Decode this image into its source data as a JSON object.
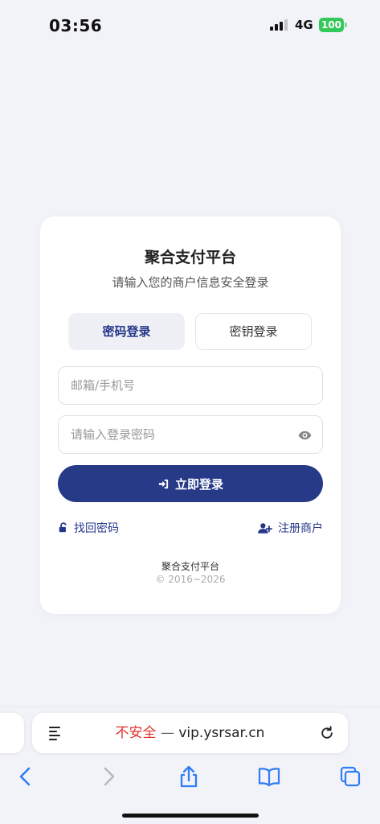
{
  "status_bar": {
    "time": "03:56",
    "network": "4G",
    "battery": "100",
    "signal_bars_active": 3,
    "signal_bars_total": 4
  },
  "login_card": {
    "title": "聚合支付平台",
    "subtitle": "请输入您的商户信息安全登录",
    "tabs": [
      {
        "label": "密码登录",
        "active": true
      },
      {
        "label": "密钥登录",
        "active": false
      }
    ],
    "email_input": {
      "placeholder": "邮箱/手机号",
      "value": ""
    },
    "password_input": {
      "placeholder": "请输入登录密码",
      "value": ""
    },
    "login_button": "立即登录",
    "forgot_link": "找回密码",
    "register_link": "注册商户",
    "footer_name": "聚合支付平台",
    "footer_copyright": "© 2016~2026"
  },
  "browser": {
    "url_warning": "不安全",
    "url_separator": "—",
    "url_domain": "vip.ysrsar.cn"
  },
  "icons": {
    "lock_open": "unlock-icon",
    "user_plus": "user-plus-icon",
    "sign_in": "sign-in-icon",
    "eye": "eye-icon",
    "reader": "reader-icon",
    "reload": "reload-icon",
    "back": "chevron-left-icon",
    "forward": "chevron-right-icon",
    "share": "share-icon",
    "bookmarks": "book-icon",
    "tabs": "tabs-icon"
  },
  "colors": {
    "brand": "#263a88",
    "background": "#f2f3f8",
    "warning": "#e0342b",
    "battery": "#34c759",
    "safari_accent": "#2f7cf6"
  }
}
